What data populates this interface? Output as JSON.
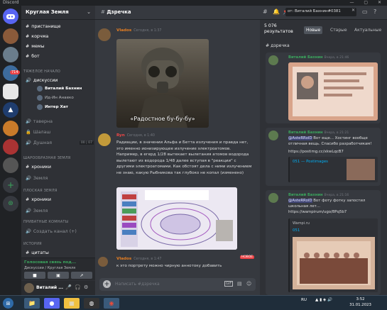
{
  "window": {
    "title": "Discord",
    "controls": "— ▢ ✕"
  },
  "guild": {
    "name": "Круглая Земля"
  },
  "channels": {
    "top": [
      {
        "icon": "#",
        "name": "пристанище"
      },
      {
        "icon": "#",
        "name": "корчма"
      },
      {
        "icon": "#",
        "name": "мемы"
      },
      {
        "icon": "#",
        "name": "бот"
      }
    ],
    "category1": "ТЯЖЕЛОЕ НАЧАЛО",
    "voice": {
      "name": "дискуссии",
      "users": [
        "Виталий Бахнин",
        "Ид-Ин Анаеко",
        "Интер Хат"
      ]
    },
    "tavern": "таверна",
    "shalash": "Шалаш",
    "dushnaya": {
      "name": "Душная",
      "count": "00",
      "limit": "07"
    },
    "category2": "ШАРООБРАЗНАЯ ЗЕМЛЯ",
    "hroniki1": "хроники",
    "zemlya1": "Земля",
    "category3": "ПЛОСКАЯ ЗЕМЛЯ",
    "hroniki2": "хроники",
    "zemlya2": "Земля",
    "category4": "ПРИВАТНЫЕ КОМНАТЫ",
    "create": "Создать канал (+)",
    "category5": "ИСТОРИЯ",
    "citaty": "цитаты",
    "selected": "Дзречка"
  },
  "voice_status": {
    "status": "Голосовая связь под...",
    "sub": "Дискуссии / Круглая Земля"
  },
  "user": {
    "name": "Виталий ..."
  },
  "chat": {
    "channel": "Дзречка",
    "msg1": {
      "user": "Vlados",
      "time": "Сегодня, в 1:37",
      "caption": "«Радостное бу-бу-бу»"
    },
    "msg2": {
      "user": "Ryn",
      "time": "Сегодня, в 1:40",
      "text": "Радиации, в значении Альфа и Бетта излучения и правда нет, это именно ионизирующее излучение электроатомов. Например, в егерд 1/28 вытекает вылетания атомов водорода вылетают из водорода 1/48 далее вступая в \"реакции\" с другими электроатомами. Как обстоят дела с ними излучением не знаю, какую Рыбникова так глубоко не копал (изменено)"
    },
    "msg3": {
      "user": "Vlados",
      "time": "Сегодня, в 1:47",
      "badge": "НОВОЕ",
      "text": "к это портрету можно чирную аннотоку добавить"
    },
    "composer_placeholder": "Написать #дзречка"
  },
  "search": {
    "query": "от: Виталий Бахнин#0381",
    "results": "5 076 результатов",
    "tabs": [
      "Новые",
      "Старые",
      "Актуальные"
    ],
    "channel": "дзречка",
    "r1": {
      "user": "Виталий Бахнин",
      "time": "Вчера, в 21:46"
    },
    "r2": {
      "user": "Виталий Бахнин",
      "time": "Вчера, в 21:21",
      "mention": "@AsteRRolD",
      "text": "Вот еще... Хостинг вообще отличная вещь. Спасибо разработчикам!",
      "link": "https://postimg.cc/xkwLqcB7",
      "embed": "051 — Postimages"
    },
    "r3": {
      "user": "Виталий Бахнин",
      "time": "Вчера, в 21:16",
      "mention": "@AsteRRolD",
      "text": "Вот фоту фотку запостил школьная лет...",
      "link": "https://wampirum/ugo/8Pq5b7",
      "embed_site": "Wampi.ru",
      "embed_title": "051"
    }
  },
  "taskbar": {
    "lang": "RU",
    "time": "3:52",
    "date": "31.01.2023"
  }
}
